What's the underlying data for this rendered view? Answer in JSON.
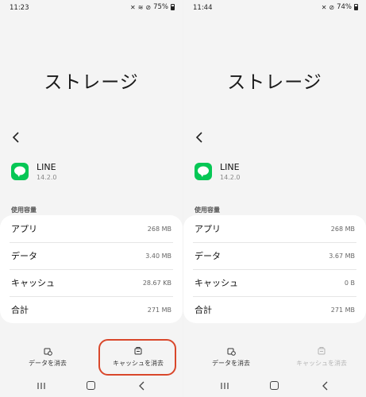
{
  "screens": [
    {
      "status": {
        "time": "11:23",
        "battery": "75%"
      },
      "title": "ストレージ",
      "app": {
        "name": "LINE",
        "version": "14.2.0"
      },
      "section_label": "使用容量",
      "rows": [
        {
          "label": "アプリ",
          "value": "268 MB"
        },
        {
          "label": "データ",
          "value": "3.40 MB"
        },
        {
          "label": "キャッシュ",
          "value": "28.67 KB"
        },
        {
          "label": "合計",
          "value": "271 MB"
        }
      ],
      "actions": {
        "clear_data": "データを消去",
        "clear_cache": "キャッシュを消去"
      }
    },
    {
      "status": {
        "time": "11:44",
        "battery": "74%"
      },
      "title": "ストレージ",
      "app": {
        "name": "LINE",
        "version": "14.2.0"
      },
      "section_label": "使用容量",
      "rows": [
        {
          "label": "アプリ",
          "value": "268 MB"
        },
        {
          "label": "データ",
          "value": "3.67 MB"
        },
        {
          "label": "キャッシュ",
          "value": "0 B"
        },
        {
          "label": "合計",
          "value": "271 MB"
        }
      ],
      "actions": {
        "clear_data": "データを消去",
        "clear_cache": "キャッシュを消去"
      }
    }
  ],
  "colors": {
    "line_green": "#06c755",
    "highlight": "#d9472b"
  }
}
